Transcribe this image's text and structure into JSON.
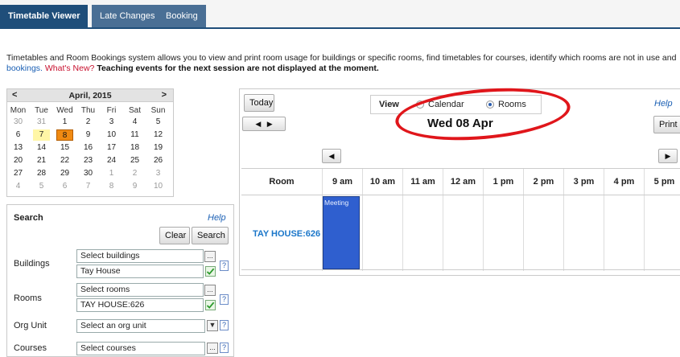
{
  "tabs": [
    {
      "label": "Timetable Viewer",
      "active": true
    },
    {
      "label": "Late Changes",
      "active": false
    },
    {
      "label": "Booking",
      "active": false
    }
  ],
  "intro": {
    "line1": "Timetables and Room Bookings system allows you to view and print room usage for buildings or specific rooms, find timetables for courses, identify which rooms are not in use and",
    "bookings_link": "bookings.",
    "whats_new": "What's New?",
    "notice": "Teaching events for the next session are not displayed at the moment."
  },
  "mini_calendar": {
    "prev": "<",
    "next": ">",
    "title": "April, 2015",
    "weekdays": [
      "Mon",
      "Tue",
      "Wed",
      "Thu",
      "Fri",
      "Sat",
      "Sun"
    ],
    "weeks": [
      [
        "30",
        "31",
        "1",
        "2",
        "3",
        "4",
        "5"
      ],
      [
        "6",
        "7",
        "8",
        "9",
        "10",
        "11",
        "12"
      ],
      [
        "13",
        "14",
        "15",
        "16",
        "17",
        "18",
        "19"
      ],
      [
        "20",
        "21",
        "22",
        "23",
        "24",
        "25",
        "26"
      ],
      [
        "27",
        "28",
        "29",
        "30",
        "1",
        "2",
        "3"
      ],
      [
        "4",
        "5",
        "6",
        "7",
        "8",
        "9",
        "10"
      ]
    ],
    "today": "7",
    "selected": "8"
  },
  "search": {
    "title": "Search",
    "help": "Help",
    "clear": "Clear",
    "search": "Search",
    "buildings_label": "Buildings",
    "buildings_select": "Select buildings",
    "buildings_value": "Tay House",
    "rooms_label": "Rooms",
    "rooms_select": "Select rooms",
    "rooms_value": "TAY HOUSE:626",
    "org_label": "Org Unit",
    "org_select": "Select an org unit",
    "courses_label": "Courses",
    "courses_select": "Select courses",
    "question": "?",
    "ellipsis": "..."
  },
  "main": {
    "today": "Today",
    "view_label": "View",
    "calendar_option": "Calendar",
    "rooms_option": "Rooms",
    "selected_view": "Rooms",
    "help": "Help",
    "print": "Print",
    "date": "Wed 08 Apr",
    "room_header": "Room",
    "times": [
      "9 am",
      "10 am",
      "11 am",
      "12 am",
      "1 pm",
      "2 pm",
      "3 pm",
      "4 pm",
      "5 pm"
    ],
    "room": "TAY HOUSE:626",
    "event": "Meeting"
  },
  "colors": {
    "tab_active": "#1f4e7a",
    "event": "#2f5fcf",
    "annotation": "#e0161b"
  }
}
